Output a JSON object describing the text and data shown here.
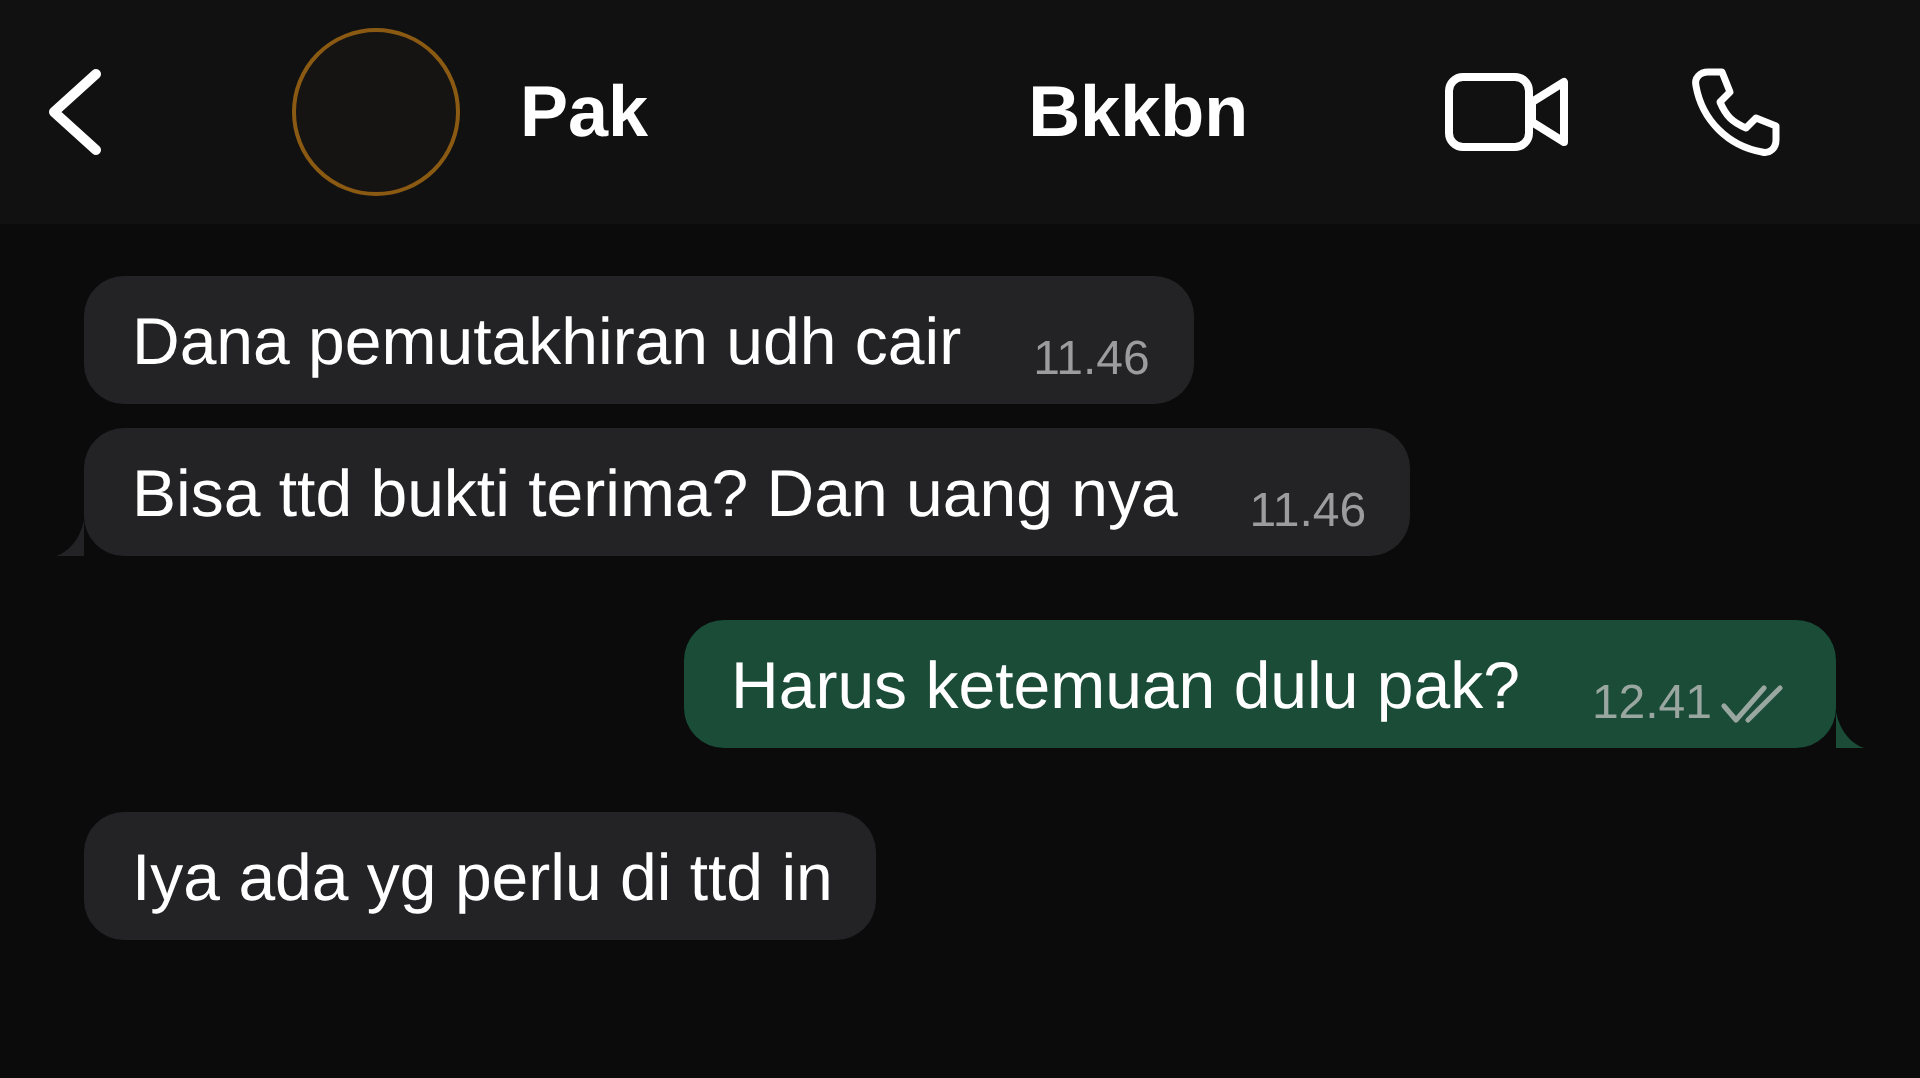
{
  "header": {
    "name_parts": [
      "Pak",
      "Bkkbn"
    ]
  },
  "messages": [
    {
      "kind": "incoming",
      "text": "Dana pemutakhiran udh cair",
      "time": "11.46",
      "tail": false
    },
    {
      "kind": "incoming",
      "text": "Bisa ttd bukti terima? Dan uang nya",
      "time": "11.46",
      "tail": true
    },
    {
      "kind": "outgoing",
      "text": "Harus ketemuan dulu pak?",
      "time": "12.41",
      "tail": true,
      "read": false
    },
    {
      "kind": "incoming",
      "text": "Iya ada yg perlu di ttd in",
      "tail": false
    }
  ]
}
